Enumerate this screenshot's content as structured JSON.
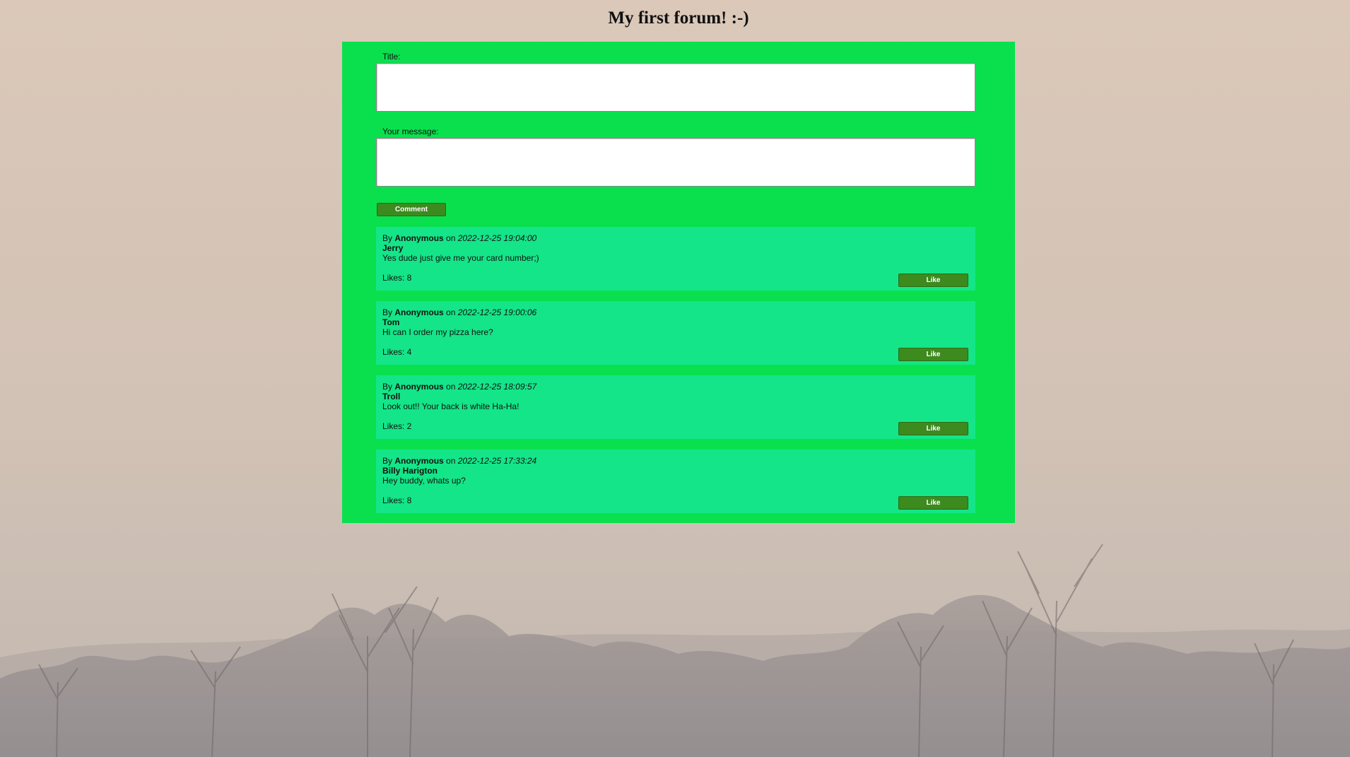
{
  "page": {
    "title": "My first forum! :-)"
  },
  "form": {
    "title_label": "Title:",
    "title_value": "",
    "message_label": "Your message:",
    "message_value": "",
    "submit_label": "Comment"
  },
  "posts": [
    {
      "by_prefix": "By",
      "author": "Anonymous",
      "on_word": "on",
      "timestamp": "2022-12-25 19:04:00",
      "title": "Jerry",
      "body": "Yes dude just give me your card number;)",
      "likes_text": "Likes: 8",
      "like_label": "Like"
    },
    {
      "by_prefix": "By",
      "author": "Anonymous",
      "on_word": "on",
      "timestamp": "2022-12-25 19:00:06",
      "title": "Tom",
      "body": "Hi can I order my pizza here?",
      "likes_text": "Likes: 4",
      "like_label": "Like"
    },
    {
      "by_prefix": "By",
      "author": "Anonymous",
      "on_word": "on",
      "timestamp": "2022-12-25 18:09:57",
      "title": "Troll",
      "body": "Look out!! Your back is white Ha-Ha!",
      "likes_text": "Likes: 2",
      "like_label": "Like"
    },
    {
      "by_prefix": "By",
      "author": "Anonymous",
      "on_word": "on",
      "timestamp": "2022-12-25 17:33:24",
      "title": "Billy Harigton",
      "body": "Hey buddy, whats up?",
      "likes_text": "Likes: 8",
      "like_label": "Like"
    }
  ],
  "colors": {
    "panel": "#0ae04e",
    "post_card": "#14e588",
    "button": "#3d8a1f"
  }
}
